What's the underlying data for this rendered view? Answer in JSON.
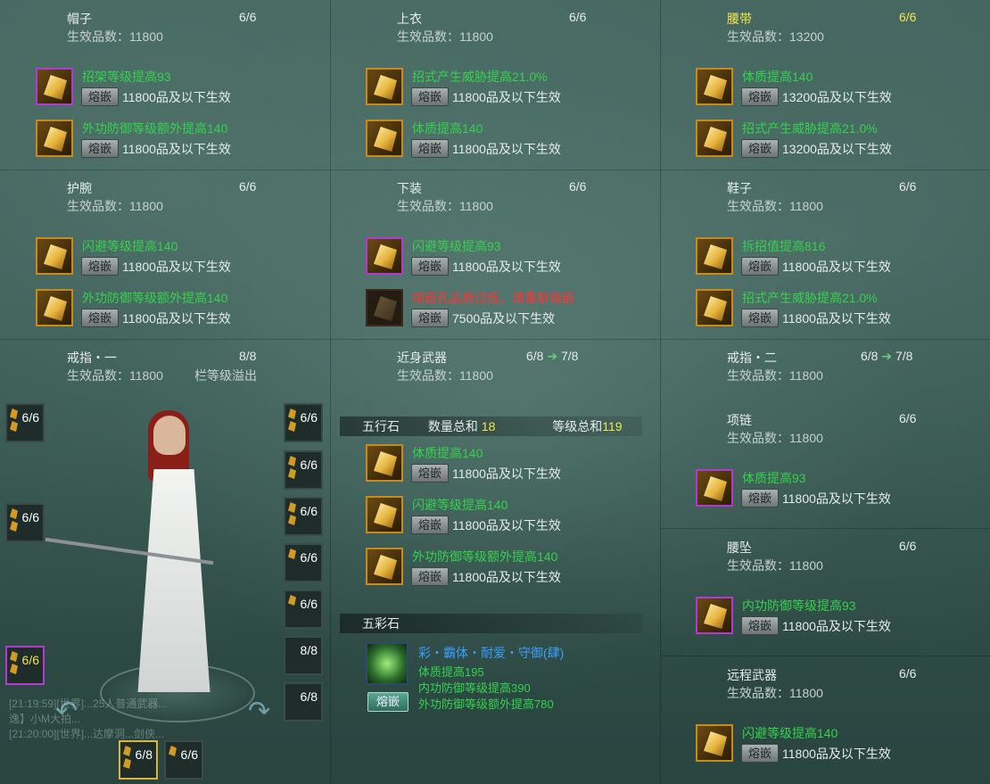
{
  "colors": {
    "green_attr": "#34d24d",
    "red_warn": "#ff3434",
    "yellow": "#f4e64a",
    "gem_gold_border": "#c78a1c",
    "gem_purple_border": "#b33ad1",
    "blue_name": "#3aa0ff"
  },
  "slots": {
    "hat": {
      "name": "帽子",
      "count": "6/6",
      "level": "生效品数：11800",
      "gems": [
        {
          "attr": "招架等级提高93",
          "btn": "熔嵌",
          "eff": "11800品及以下生效",
          "icon": "gem-icon-purple"
        },
        {
          "attr": "外功防御等级额外提高140",
          "btn": "熔嵌",
          "eff": "11800品及以下生效",
          "icon": "gem-icon-gold"
        }
      ]
    },
    "coat": {
      "name": "上衣",
      "count": "6/6",
      "level": "生效品数：11800",
      "gems": [
        {
          "attr": "招式产生威胁提高21.0%",
          "btn": "熔嵌",
          "eff": "11800品及以下生效",
          "icon": "gem-icon-gold"
        },
        {
          "attr": "体质提高140",
          "btn": "熔嵌",
          "eff": "11800品及以下生效",
          "icon": "gem-icon-gold"
        }
      ]
    },
    "belt": {
      "name": "腰带",
      "count": "6/6",
      "level": "生效品数：13200",
      "gems": [
        {
          "attr": "体质提高140",
          "btn": "熔嵌",
          "eff": "13200品及以下生效",
          "icon": "gem-icon-gold"
        },
        {
          "attr": "招式产生威胁提高21.0%",
          "btn": "熔嵌",
          "eff": "13200品及以下生效",
          "icon": "gem-icon-gold"
        }
      ]
    },
    "wrist": {
      "name": "护腕",
      "count": "6/6",
      "level": "生效品数：11800",
      "gems": [
        {
          "attr": "闪避等级提高140",
          "btn": "熔嵌",
          "eff": "11800品及以下生效",
          "icon": "gem-icon-gold"
        },
        {
          "attr": "外功防御等级额外提高140",
          "btn": "熔嵌",
          "eff": "11800品及以下生效",
          "icon": "gem-icon-gold"
        }
      ]
    },
    "pants": {
      "name": "下装",
      "count": "6/6",
      "level": "生效品数：11800",
      "gems": [
        {
          "attr": "闪避等级提高93",
          "btn": "熔嵌",
          "eff": "11800品及以下生效",
          "icon": "gem-icon-purple"
        },
        {
          "attr": "熔嵌孔品质过低，请重新熔嵌",
          "btn": "熔嵌",
          "eff": "7500品及以下生效",
          "icon": "gem-icon-dark"
        }
      ]
    },
    "shoes": {
      "name": "鞋子",
      "count": "6/6",
      "level": "生效品数：11800",
      "gems": [
        {
          "attr": "拆招值提高816",
          "btn": "熔嵌",
          "eff": "11800品及以下生效",
          "icon": "gem-icon-gold"
        },
        {
          "attr": "招式产生威胁提高21.0%",
          "btn": "熔嵌",
          "eff": "11800品及以下生效",
          "icon": "gem-icon-gold"
        }
      ]
    },
    "ring1": {
      "name": "戒指・一",
      "count": "8/8",
      "level": "生效品数：11800",
      "overflow": "栏等级溢出"
    },
    "melee": {
      "name": "近身武器",
      "count": "6/8",
      "upgrade": "7/8",
      "level": "生效品数：11800"
    },
    "ring2": {
      "name": "戒指・二",
      "count": "6/8",
      "upgrade": "7/8",
      "level": "生效品数：11800"
    },
    "necklace": {
      "name": "项链",
      "count": "6/6",
      "level": "生效品数：11800",
      "gems": [
        {
          "attr": "体质提高93",
          "btn": "熔嵌",
          "eff": "11800品及以下生效",
          "icon": "gem-icon-purple"
        }
      ]
    },
    "pendant": {
      "name": "腰坠",
      "count": "6/6",
      "level": "生效品数：11800",
      "gems": [
        {
          "attr": "内功防御等级提高93",
          "btn": "熔嵌",
          "eff": "11800品及以下生效",
          "icon": "gem-icon-gold"
        }
      ]
    },
    "ranged": {
      "name": "远程武器",
      "count": "6/6",
      "level": "生效品数：11800",
      "gems": [
        {
          "attr": "闪避等级提高140",
          "btn": "熔嵌",
          "eff": "11800品及以下生效",
          "icon": "gem-icon-gold"
        }
      ]
    }
  },
  "wuxing": {
    "title": "五行石",
    "qty_label": "数量总和",
    "qty_value": "18",
    "lvl_label": "等级总和",
    "lvl_value": "119",
    "gems": [
      {
        "attr": "体质提高140",
        "btn": "熔嵌",
        "eff": "11800品及以下生效"
      },
      {
        "attr": "闪避等级提高140",
        "btn": "熔嵌",
        "eff": "11800品及以下生效"
      },
      {
        "attr": "外功防御等级额外提高140",
        "btn": "熔嵌",
        "eff": "11800品及以下生效"
      }
    ]
  },
  "wucai": {
    "title": "五彩石",
    "name": "彩・霸体・耐爱・守御(肆)",
    "lines": [
      "体质提高195",
      "内功防御等级提高390",
      "外功防御等级额外提高780"
    ],
    "btn": "熔嵌"
  },
  "equip_slots": {
    "left": [
      "6/6",
      "6/6",
      "6/6"
    ],
    "right": [
      "6/6",
      "6/6",
      "6/6",
      "6/6",
      "6/6",
      "8/8",
      "6/8"
    ],
    "bottom": [
      "6/8",
      "6/6"
    ]
  },
  "chat": [
    "[21:19:59][世界]...25人普通武器...",
    "逸】小M大拍...",
    "[21:20:00][世界]...达摩洞...剑侠..."
  ]
}
